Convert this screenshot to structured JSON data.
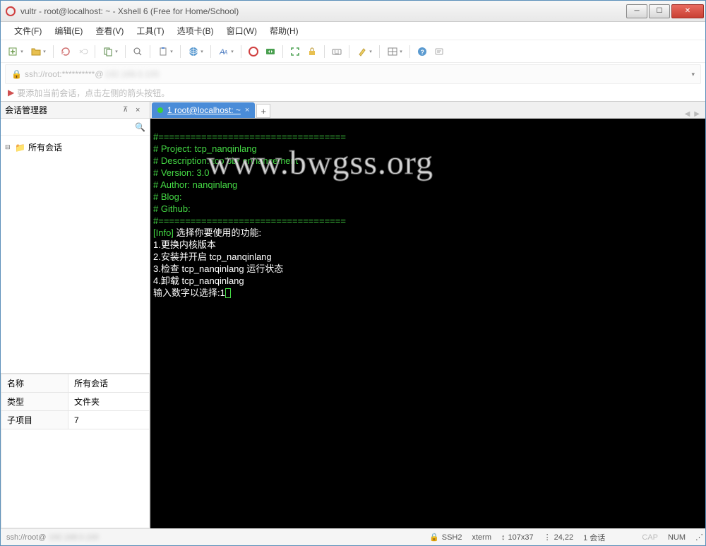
{
  "window": {
    "title": "vultr - root@localhost: ~ - Xshell 6 (Free for Home/School)"
  },
  "menu": [
    "文件(F)",
    "编辑(E)",
    "查看(V)",
    "工具(T)",
    "选项卡(B)",
    "窗口(W)",
    "帮助(H)"
  ],
  "address": "ssh://root:**********@",
  "hint": "要添加当前会话，点击左侧的箭头按钮。",
  "session_panel": {
    "title": "会话管理器",
    "tree_root": "所有会话",
    "props": [
      [
        "名称",
        "所有会话"
      ],
      [
        "类型",
        "文件夹"
      ],
      [
        "子项目",
        "7"
      ]
    ]
  },
  "tab": {
    "label": "1 root@localhost: ~"
  },
  "terminal": {
    "divider": "#===================================",
    "l1": "# Project: tcp_nanqinlang",
    "l2": "# Description: tcp bbr enhancement",
    "l3": "# Version: 3.0",
    "l4": "# Author: nanqinlang",
    "l5": "# Blog:",
    "l6": "# Github:",
    "info_tag": "[Info]",
    "info_rest": " 选择你要使用的功能:",
    "m1": "1.更换内核版本",
    "m2": "2.安装并开启 tcp_nanqinlang",
    "m3": "3.检查 tcp_nanqinlang 运行状态",
    "m4": "4.卸载 tcp_nanqinlang",
    "prompt": "输入数字以选择:1"
  },
  "watermark": "www.bwgss.org",
  "status": {
    "left": "ssh://root@",
    "ssh": "SSH2",
    "term": "xterm",
    "size": "107x37",
    "pos": "24,22",
    "sess": "1 会话",
    "cap": "CAP",
    "num": "NUM"
  }
}
